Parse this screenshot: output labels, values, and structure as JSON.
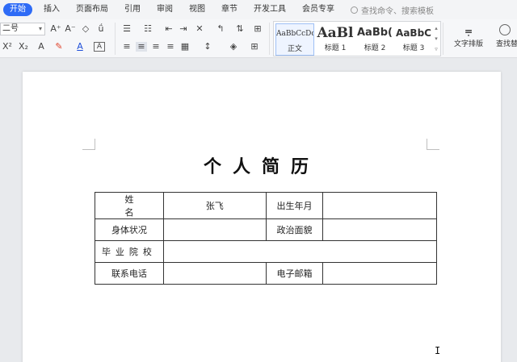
{
  "menu": {
    "items": [
      "开始",
      "插入",
      "页面布局",
      "引用",
      "审阅",
      "视图",
      "章节",
      "开发工具",
      "会员专享"
    ],
    "active": "开始",
    "search_placeholder": "查找命令、搜索模板"
  },
  "ribbon": {
    "font_size": "二号",
    "styles": [
      {
        "sample": "AaBbCcDd",
        "name": "正文"
      },
      {
        "sample": "AaBl",
        "name": "标题 1"
      },
      {
        "sample": "AaBb(",
        "name": "标题 2"
      },
      {
        "sample": "AaBbC",
        "name": "标题 3"
      }
    ],
    "text_layout_label": "文字排版",
    "find_label": "查找替换"
  },
  "document": {
    "title": "个人简历",
    "rows": [
      [
        "姓 名",
        "张飞",
        "出生年月",
        ""
      ],
      [
        "身体状况",
        "",
        "政治面貌",
        ""
      ],
      [
        "毕业院校",
        ""
      ],
      [
        "联系电话",
        "",
        "电子邮箱",
        ""
      ]
    ]
  },
  "colors": {
    "accent": "#2e6bf6",
    "page": "#ffffff",
    "workspace": "#e8eaed"
  }
}
